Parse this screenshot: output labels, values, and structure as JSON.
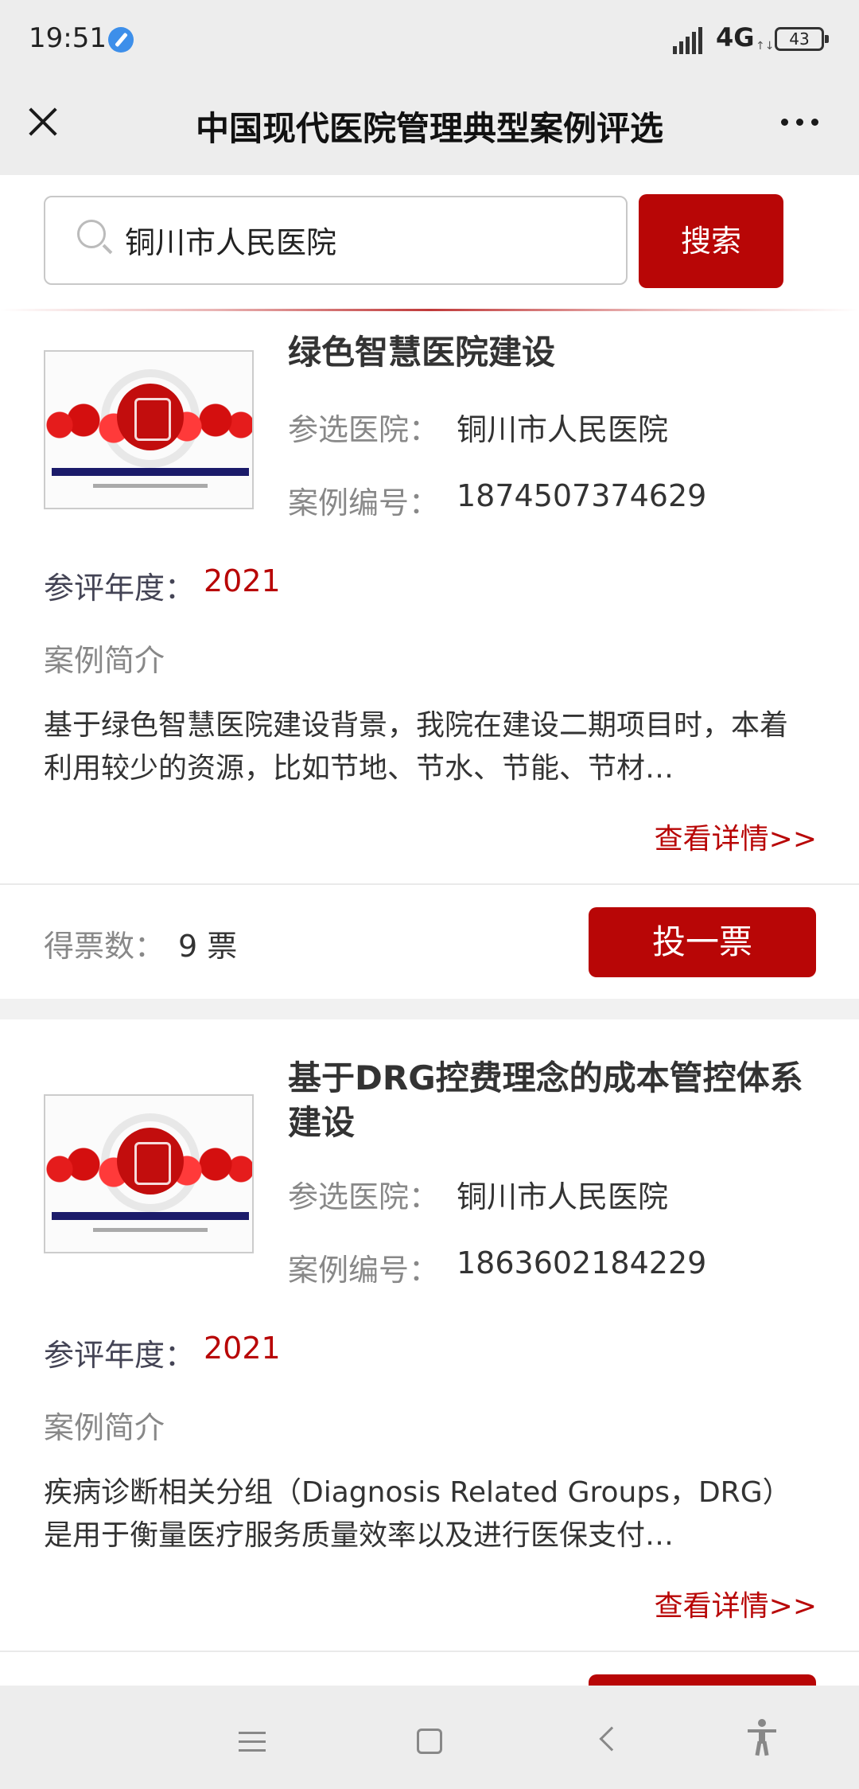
{
  "status_bar": {
    "time": "19:51",
    "network": "4G",
    "network_sub": "↑↓",
    "battery": "43"
  },
  "header": {
    "title": "中国现代医院管理典型案例评选"
  },
  "search": {
    "value": "铜川市人民医院",
    "button_label": "搜索"
  },
  "labels": {
    "hospital": "参选医院：",
    "case_no": "案例编号：",
    "year": "参评年度：",
    "intro": "案例简介",
    "detail": "查看详情>>",
    "votes": "得票数：",
    "vote_button": "投一票"
  },
  "cards": [
    {
      "title": "绿色智慧医院建设",
      "hospital": "铜川市人民医院",
      "case_no": "1874507374629",
      "year": "2021",
      "intro": "基于绿色智慧医院建设背景，我院在建设二期项目时，本着利用较少的资源，比如节地、节水、节能、节材…",
      "votes": "9 票"
    },
    {
      "title": "基于DRG控费理念的成本管控体系建设",
      "hospital": "铜川市人民医院",
      "case_no": "1863602184229",
      "year": "2021",
      "intro": "疾病诊断相关分组（Diagnosis Related Groups，DRG）是用于衡量医疗服务质量效率以及进行医保支付…"
    }
  ],
  "icons": {
    "close": "close-icon",
    "more": "more-icon",
    "search": "search-icon",
    "nav": [
      "menu-icon",
      "home-icon",
      "back-icon",
      "accessibility-icon"
    ]
  },
  "colors": {
    "accent": "#b80606",
    "header_bg": "#ededed"
  }
}
